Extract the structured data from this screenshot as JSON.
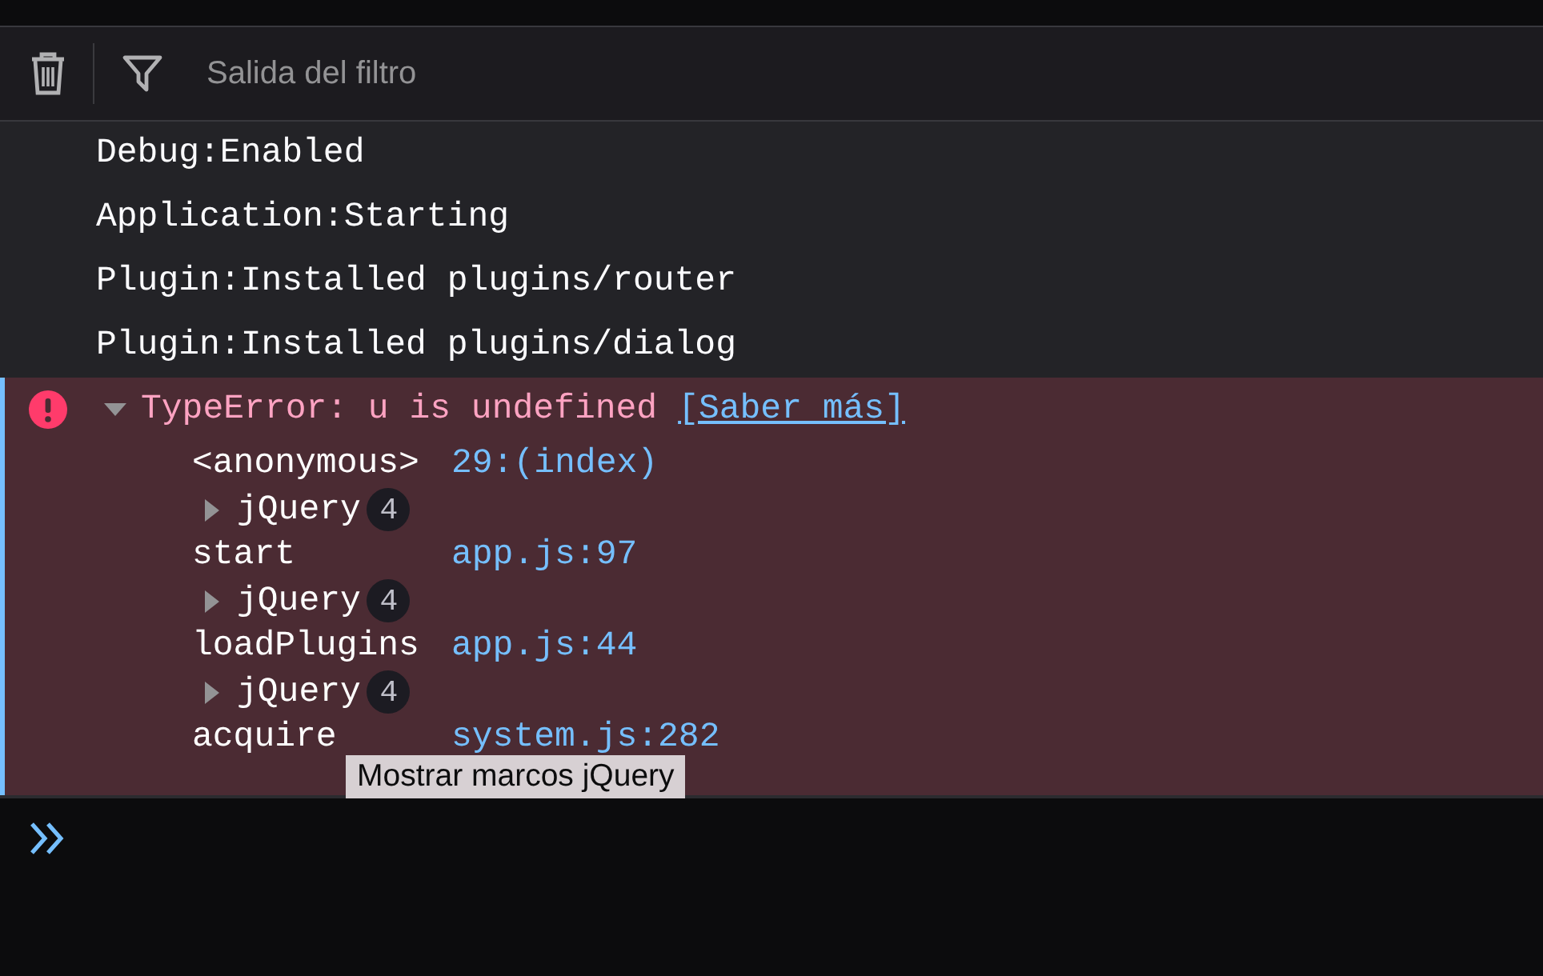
{
  "toolbar": {
    "filter": {
      "placeholder": "Salida del filtro"
    }
  },
  "messages": [
    {
      "text": "Debug:Enabled"
    },
    {
      "text": "Application:Starting"
    },
    {
      "text": "Plugin:Installed plugins/router"
    },
    {
      "text": "Plugin:Installed plugins/dialog"
    }
  ],
  "error": {
    "message": "TypeError: u is undefined",
    "link": "[Saber más]",
    "expanded": true,
    "frames": [
      {
        "kind": "frame",
        "name": "<anonymous>",
        "location": "29:(index)"
      },
      {
        "kind": "group",
        "label": "jQuery",
        "count": "4",
        "expanded": false
      },
      {
        "kind": "frame",
        "name": "start",
        "location": "app.js:97"
      },
      {
        "kind": "group",
        "label": "jQuery",
        "count": "4",
        "expanded": false
      },
      {
        "kind": "frame",
        "name": "loadPlugins",
        "location": "app.js:44"
      },
      {
        "kind": "group",
        "label": "jQuery",
        "count": "4",
        "expanded": false
      },
      {
        "kind": "frame",
        "name": "acquire",
        "location": "system.js:282"
      }
    ]
  },
  "tooltip": "Mostrar marcos jQuery"
}
